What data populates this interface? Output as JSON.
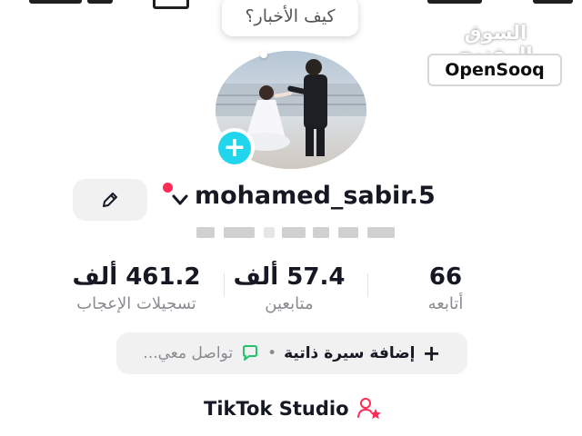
{
  "watermark": {
    "arabic": "السوق المفتوح",
    "english": "OpenSooq"
  },
  "profile": {
    "bubble_text": "كيف الأخبار؟",
    "username": "mohamed_sabir.5"
  },
  "stats": [
    {
      "value": "461.2 ألف",
      "label": "تسجيلات الإعجاب"
    },
    {
      "value": "57.4 ألف",
      "label": "متابعين"
    },
    {
      "value": "66",
      "label": "أتابعه"
    }
  ],
  "bio": {
    "add_bio": "إضافة سيرة ذاتية",
    "separator": "•",
    "contact": "تواصل معي..."
  },
  "studio": {
    "label": "TikTok Studio"
  },
  "colors": {
    "accent_cyan": "#20d5ec",
    "accent_red": "#fe2c55",
    "pill_bg": "#f1f1f2",
    "text_primary": "#161823",
    "text_secondary": "#8a8b91"
  },
  "icons": [
    "pencil-icon",
    "chevron-down-icon",
    "plus-icon",
    "chat-bubble-icon",
    "person-star-icon"
  ]
}
